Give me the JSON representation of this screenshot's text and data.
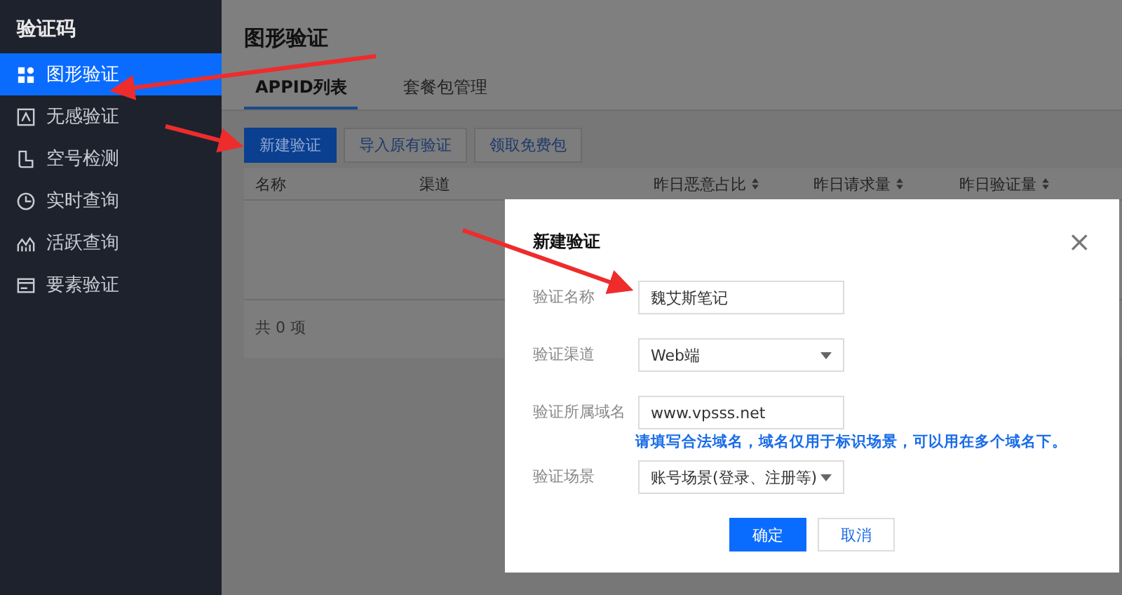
{
  "sidebar": {
    "title": "验证码",
    "items": [
      {
        "label": "图形验证",
        "selected": true
      },
      {
        "label": "无感验证",
        "selected": false
      },
      {
        "label": "空号检测",
        "selected": false
      },
      {
        "label": "实时查询",
        "selected": false
      },
      {
        "label": "活跃查询",
        "selected": false
      },
      {
        "label": "要素验证",
        "selected": false
      }
    ]
  },
  "page": {
    "title": "图形验证",
    "tabs": [
      {
        "label": "APPID列表",
        "selected": true
      },
      {
        "label": "套餐包管理",
        "selected": false
      }
    ],
    "buttons": [
      {
        "label": "新建验证",
        "primary": true
      },
      {
        "label": "导入原有验证",
        "primary": false
      },
      {
        "label": "领取免费包",
        "primary": false
      }
    ],
    "table": {
      "columns": [
        {
          "label": "名称",
          "sortable": false
        },
        {
          "label": "渠道",
          "sortable": false
        },
        {
          "label": "昨日恶意占比",
          "sortable": true
        },
        {
          "label": "昨日请求量",
          "sortable": true
        },
        {
          "label": "昨日验证量",
          "sortable": true
        }
      ],
      "footer": "共 0 项"
    }
  },
  "dialog": {
    "title": "新建验证",
    "close": "×",
    "fields": [
      {
        "label": "验证名称",
        "kind": "text",
        "value": "魏艾斯笔记"
      },
      {
        "label": "验证渠道",
        "kind": "select",
        "value": "Web端"
      },
      {
        "label": "验证所属域名",
        "kind": "text",
        "value": "www.vpsss.net",
        "hint": "请填写合法域名，域名仅用于标识场景，可以用在多个域名下。"
      },
      {
        "label": "验证场景",
        "kind": "select",
        "value": "账号场景(登录、注册等)"
      }
    ],
    "buttons": [
      {
        "label": "确定",
        "primary": true
      },
      {
        "label": "取消",
        "primary": false
      }
    ]
  }
}
